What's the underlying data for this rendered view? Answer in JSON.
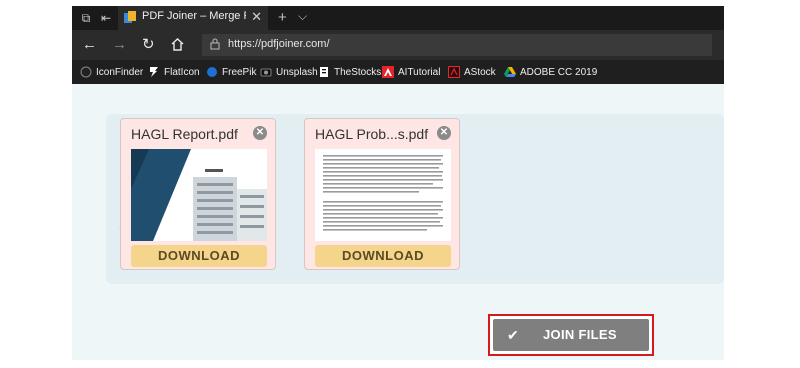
{
  "tab": {
    "title": "PDF Joiner – Merge PDF"
  },
  "address_bar": {
    "url": "https://pdfjoiner.com/"
  },
  "bookmarks": [
    {
      "label": "IconFinder",
      "icon": "iconfinder-icon"
    },
    {
      "label": "FlatIcon",
      "icon": "flaticon-icon"
    },
    {
      "label": "FreePik",
      "icon": "freepik-icon"
    },
    {
      "label": "Unsplash",
      "icon": "camera-icon"
    },
    {
      "label": "TheStocks",
      "icon": "thestocks-icon"
    },
    {
      "label": "AITutorial",
      "icon": "adobe-icon"
    },
    {
      "label": "AStock",
      "icon": "astock-icon"
    },
    {
      "label": "ADOBE CC 2019",
      "icon": "drive-icon"
    }
  ],
  "files": [
    {
      "name": "HAGL Report.pdf",
      "download_label": "DOWNLOAD"
    },
    {
      "name": "HAGL Prob...s.pdf",
      "download_label": "DOWNLOAD"
    }
  ],
  "join_button": {
    "label": "JOIN FILES"
  },
  "colors": {
    "chrome_bg": "#1f1f1f",
    "page_bg": "#eef6f8",
    "card_bg": "#fde6e3",
    "download_bg": "#f5d58c",
    "join_bg": "#7f7f7f",
    "highlight_border": "#d41a1a"
  }
}
